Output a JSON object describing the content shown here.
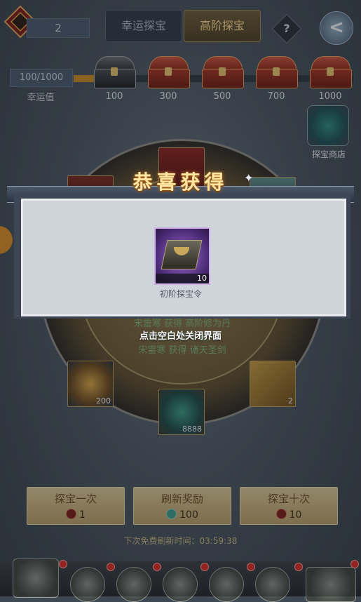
{
  "header": {
    "counter": "2",
    "tabs": [
      {
        "label": "幸运探宝",
        "active": false
      },
      {
        "label": "高阶探宝",
        "active": true
      }
    ],
    "help_label": "?",
    "back_label": "<"
  },
  "luck": {
    "value_text": "100/1000",
    "label": "幸运值",
    "progress_fraction": 0.1,
    "milestones": [
      "100",
      "300",
      "500",
      "700",
      "1000"
    ]
  },
  "shop": {
    "label": "探宝商店"
  },
  "wheel": {
    "slots": {
      "left_count": "200",
      "right_count": "2",
      "bottom_count": "8888"
    },
    "log": [
      "宋雷寒 获得 高阶修为丹",
      "宋雷寒 获得 诸天",
      "宋雷寒 获得 诸天圣剑"
    ]
  },
  "actions": [
    {
      "label": "探宝一次",
      "cost": "1",
      "coin": "red"
    },
    {
      "label": "刷新奖励",
      "cost": "100",
      "coin": "green"
    },
    {
      "label": "探宝十次",
      "cost": "10",
      "coin": "red"
    }
  ],
  "timer": {
    "text": "下次免费刷新时间：03:59:38"
  },
  "popup": {
    "title": "恭喜获得",
    "item_name": "初阶探宝令",
    "item_qty": "10",
    "close_hint": "点击空白处关闭界面"
  },
  "colors": {
    "accent_gold": "#f4d58a",
    "luck_fill": "#c98a23",
    "title_glow": "#ffe7a3"
  }
}
